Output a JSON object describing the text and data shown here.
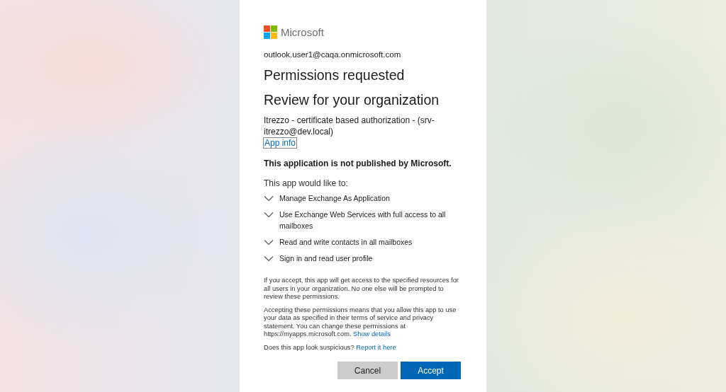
{
  "brand": "Microsoft",
  "account": "outlook.user1@caqa.onmicrosoft.com",
  "title": "Permissions requested",
  "subtitle": "Review for your organization",
  "app_name": "Itrezzo - certificate based authorization - (srv-itrezzo@dev.local)",
  "app_info_link": "App info",
  "publisher_notice": "This application is not published by Microsoft.",
  "intro": "This app would like to:",
  "permissions": [
    {
      "label": "Manage Exchange As Application",
      "expanded": false
    },
    {
      "label": "Use Exchange Web Services with full access to all mailboxes",
      "expanded": false
    },
    {
      "label": "Read and write contacts in all mailboxes",
      "expanded": false
    },
    {
      "label": "Sign in and read user profile",
      "expanded": false
    }
  ],
  "notices": [
    {
      "text": "If you accept, this app will get access to the specified resources for all users in your organization. No one else will be prompted to review these permissions."
    },
    {
      "text": "Accepting these permissions means that you allow this app to use your data as specified in their terms of service and privacy statement. You can change these permissions at https://myapps.microsoft.com.",
      "link": "Show details"
    },
    {
      "text": "Does this app look suspicious?",
      "link": "Report it here"
    }
  ],
  "buttons": [
    {
      "label": "Cancel",
      "kind": "secondary"
    },
    {
      "label": "Accept",
      "kind": "primary"
    }
  ]
}
